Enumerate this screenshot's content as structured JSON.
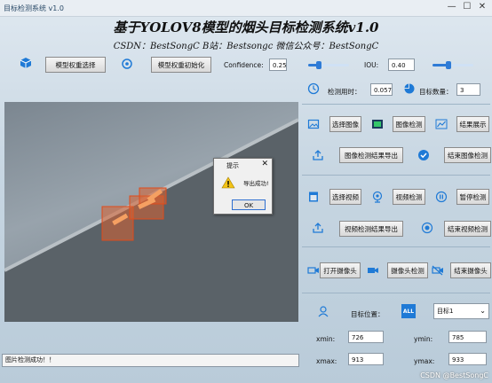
{
  "window": {
    "title": "目标检测系统 v1.0",
    "controls": [
      "—",
      "☐",
      "✕"
    ]
  },
  "header": {
    "title": "基于YOLOV8模型的烟头目标检测系统v1.0",
    "subtitle": "CSDN：BestSongC   B站：Bestsongc   微信公众号：BestSongC"
  },
  "toolbar": {
    "select_model": "模型权重选择",
    "init_model": "模型权重初始化",
    "confidence_label": "Confidence:",
    "confidence_value": "0.25",
    "confidence_level": 0.25,
    "iou_label": "IOU:",
    "iou_value": "0.40",
    "iou_level": 0.4
  },
  "stats": {
    "time_label": "检测用时：",
    "time_value": "0.057",
    "count_label": "目标数量：",
    "count_value": "3"
  },
  "image_section": {
    "select_image": "选择图像",
    "detect_image": "图像检测",
    "show_results": "结果展示",
    "export_image": "图像检测结果导出",
    "stop_image": "结束图像检测"
  },
  "video_section": {
    "select_video": "选择视频",
    "detect_video": "视频检测",
    "pause": "暂停检测",
    "export_video": "视频检测结果导出",
    "stop_video": "结束视频检测"
  },
  "camera_section": {
    "open_camera": "打开摄像头",
    "camera_detect": "摄像头检测",
    "close_camera": "结束摄像头"
  },
  "target": {
    "label": "目标位置：",
    "select": "目标1",
    "xmin_label": "xmin:",
    "xmin": "726",
    "ymin_label": "ymin:",
    "ymin": "785",
    "xmax_label": "xmax:",
    "xmax": "913",
    "ymax_label": "ymax:",
    "ymax": "933"
  },
  "status": "图片检测成功！！",
  "dialog": {
    "title": "提示",
    "message": "导出成功!",
    "ok": "OK"
  },
  "watermark": "CSDN @BestSongC"
}
